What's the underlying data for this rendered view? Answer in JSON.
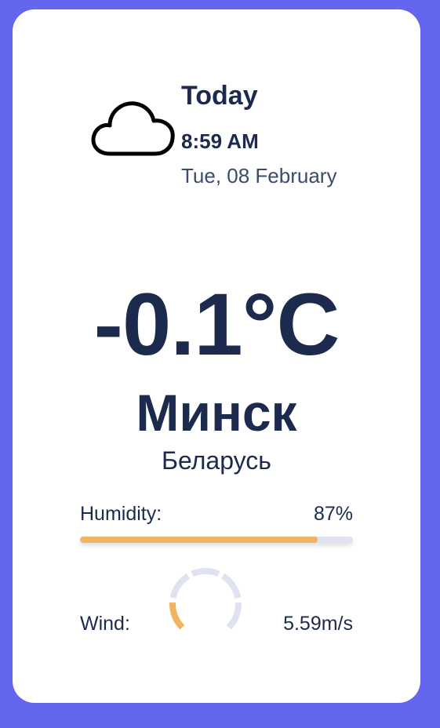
{
  "header": {
    "title": "Today",
    "time": "8:59 AM",
    "date": "Tue, 08 February",
    "icon": "cloud-icon"
  },
  "weather": {
    "temperature": "-0.1°C",
    "city": "Минск",
    "country": "Беларусь"
  },
  "humidity": {
    "label": "Humidity:",
    "value": "87%",
    "percent": 87
  },
  "wind": {
    "label": "Wind:",
    "value": "5.59m/s",
    "gauge_level": 0.2
  },
  "colors": {
    "background": "#6466ee",
    "text": "#1c2a4e",
    "accent": "#f0b360",
    "track": "#dfe2f1"
  }
}
